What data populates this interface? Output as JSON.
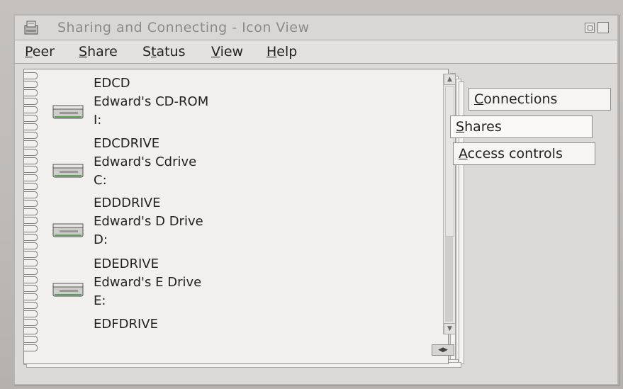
{
  "window": {
    "title": "Sharing and Connecting - Icon View"
  },
  "menu": [
    {
      "label": "Peer",
      "mnemonic": "P",
      "rest": "eer"
    },
    {
      "label": "Share",
      "mnemonic": "S",
      "rest": "hare"
    },
    {
      "label": "Status",
      "pre": "S",
      "mnemonic": "t",
      "rest": "atus"
    },
    {
      "label": "View",
      "mnemonic": "V",
      "rest": "iew"
    },
    {
      "label": "Help",
      "mnemonic": "H",
      "rest": "elp"
    }
  ],
  "items": [
    {
      "lines": [
        "EDCD",
        "Edward's CD-ROM",
        "I:"
      ],
      "icon": "drive-icon"
    },
    {
      "lines": [
        "EDCDRIVE",
        "Edward's Cdrive",
        "C:"
      ],
      "icon": "drive-icon"
    },
    {
      "lines": [
        "EDDDRIVE",
        "Edward's D Drive",
        "D:"
      ],
      "icon": "drive-icon"
    },
    {
      "lines": [
        "EDEDRIVE",
        "Edward's E Drive",
        "E:"
      ],
      "icon": "drive-icon"
    },
    {
      "lines": [
        "EDFDRIVE"
      ],
      "icon": "drive-icon"
    }
  ],
  "tabs": [
    {
      "label": "Connections",
      "mnemonic": "C",
      "rest": "onnections",
      "selected": false
    },
    {
      "label": "Shares",
      "mnemonic": "S",
      "rest": "hares",
      "selected": true
    },
    {
      "label": "Access controls",
      "mnemonic": "A",
      "rest": "ccess controls",
      "selected": false
    }
  ],
  "colors": {
    "background": "#b9b6b4",
    "page": "#f1f0ee",
    "title_text": "#8d8b89"
  }
}
